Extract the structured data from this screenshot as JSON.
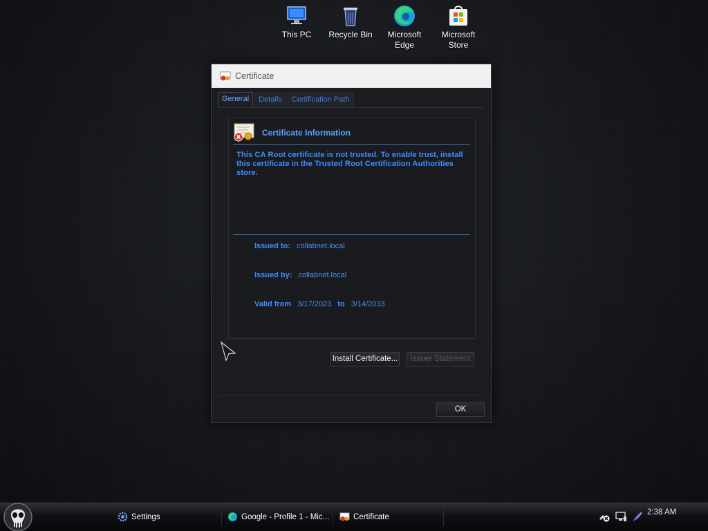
{
  "desktop": {
    "icons": [
      {
        "label": "This PC",
        "icon": "this-pc-icon"
      },
      {
        "label": "Recycle Bin",
        "icon": "recycle-bin-icon"
      },
      {
        "label": "Microsoft Edge",
        "icon": "edge-icon"
      },
      {
        "label": "Microsoft Store",
        "icon": "store-icon"
      }
    ]
  },
  "dialog": {
    "title": "Certificate",
    "tabs": [
      "General",
      "Details",
      "Certification Path"
    ],
    "info_title": "Certificate Information",
    "warning": "This CA Root certificate is not trusted. To enable trust, install this certificate in the Trusted Root Certification Authorities store.",
    "issued_to_label": "Issued to:",
    "issued_to": "collabnet.local",
    "issued_by_label": "Issued by:",
    "issued_by": "collabnet.local",
    "valid_from_label": "Valid from",
    "valid_from": "3/17/2023",
    "valid_to_label": "to",
    "valid_to": "3/14/2033",
    "install_button": "Install Certificate...",
    "issuer_button": "Issuer Statement",
    "ok_button": "OK"
  },
  "taskbar": {
    "items": [
      {
        "label": "Settings",
        "icon": "settings-gear-icon"
      },
      {
        "label": "Google - Profile 1 - Mic...",
        "icon": "edge-icon"
      },
      {
        "label": "Certificate",
        "icon": "certificate-icon"
      }
    ],
    "clock": "2:38 AM"
  }
}
